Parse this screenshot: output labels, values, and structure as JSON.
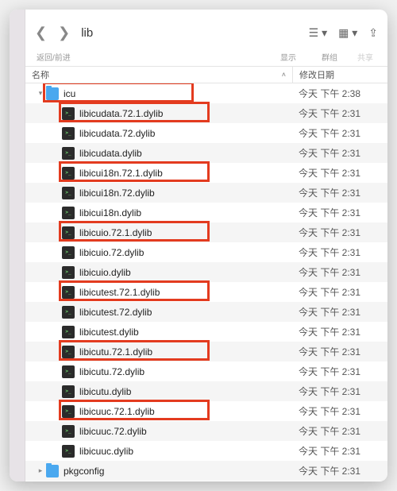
{
  "toolbar": {
    "back_forward_label": "返回/前进",
    "title": "lib",
    "view_label": "显示",
    "group_label": "群组",
    "share_label": "共享"
  },
  "header": {
    "name_col": "名称",
    "date_col": "修改日期"
  },
  "rows": [
    {
      "name": "icu",
      "date": "今天 下午 2:38",
      "type": "folder",
      "expandable": true,
      "expanded": true,
      "depth": 0,
      "highlight": true
    },
    {
      "name": "libicudata.72.1.dylib",
      "date": "今天 下午 2:31",
      "type": "file",
      "expandable": false,
      "expanded": false,
      "depth": 1,
      "highlight": true
    },
    {
      "name": "libicudata.72.dylib",
      "date": "今天 下午 2:31",
      "type": "file",
      "expandable": false,
      "expanded": false,
      "depth": 1,
      "highlight": false
    },
    {
      "name": "libicudata.dylib",
      "date": "今天 下午 2:31",
      "type": "file",
      "expandable": false,
      "expanded": false,
      "depth": 1,
      "highlight": false
    },
    {
      "name": "libicui18n.72.1.dylib",
      "date": "今天 下午 2:31",
      "type": "file",
      "expandable": false,
      "expanded": false,
      "depth": 1,
      "highlight": true
    },
    {
      "name": "libicui18n.72.dylib",
      "date": "今天 下午 2:31",
      "type": "file",
      "expandable": false,
      "expanded": false,
      "depth": 1,
      "highlight": false
    },
    {
      "name": "libicui18n.dylib",
      "date": "今天 下午 2:31",
      "type": "file",
      "expandable": false,
      "expanded": false,
      "depth": 1,
      "highlight": false
    },
    {
      "name": "libicuio.72.1.dylib",
      "date": "今天 下午 2:31",
      "type": "file",
      "expandable": false,
      "expanded": false,
      "depth": 1,
      "highlight": true
    },
    {
      "name": "libicuio.72.dylib",
      "date": "今天 下午 2:31",
      "type": "file",
      "expandable": false,
      "expanded": false,
      "depth": 1,
      "highlight": false
    },
    {
      "name": "libicuio.dylib",
      "date": "今天 下午 2:31",
      "type": "file",
      "expandable": false,
      "expanded": false,
      "depth": 1,
      "highlight": false
    },
    {
      "name": "libicutest.72.1.dylib",
      "date": "今天 下午 2:31",
      "type": "file",
      "expandable": false,
      "expanded": false,
      "depth": 1,
      "highlight": true
    },
    {
      "name": "libicutest.72.dylib",
      "date": "今天 下午 2:31",
      "type": "file",
      "expandable": false,
      "expanded": false,
      "depth": 1,
      "highlight": false
    },
    {
      "name": "libicutest.dylib",
      "date": "今天 下午 2:31",
      "type": "file",
      "expandable": false,
      "expanded": false,
      "depth": 1,
      "highlight": false
    },
    {
      "name": "libicutu.72.1.dylib",
      "date": "今天 下午 2:31",
      "type": "file",
      "expandable": false,
      "expanded": false,
      "depth": 1,
      "highlight": true
    },
    {
      "name": "libicutu.72.dylib",
      "date": "今天 下午 2:31",
      "type": "file",
      "expandable": false,
      "expanded": false,
      "depth": 1,
      "highlight": false
    },
    {
      "name": "libicutu.dylib",
      "date": "今天 下午 2:31",
      "type": "file",
      "expandable": false,
      "expanded": false,
      "depth": 1,
      "highlight": false
    },
    {
      "name": "libicuuc.72.1.dylib",
      "date": "今天 下午 2:31",
      "type": "file",
      "expandable": false,
      "expanded": false,
      "depth": 1,
      "highlight": true
    },
    {
      "name": "libicuuc.72.dylib",
      "date": "今天 下午 2:31",
      "type": "file",
      "expandable": false,
      "expanded": false,
      "depth": 1,
      "highlight": false
    },
    {
      "name": "libicuuc.dylib",
      "date": "今天 下午 2:31",
      "type": "file",
      "expandable": false,
      "expanded": false,
      "depth": 1,
      "highlight": false
    },
    {
      "name": "pkgconfig",
      "date": "今天 下午 2:31",
      "type": "folder",
      "expandable": true,
      "expanded": false,
      "depth": 0,
      "highlight": false
    }
  ]
}
